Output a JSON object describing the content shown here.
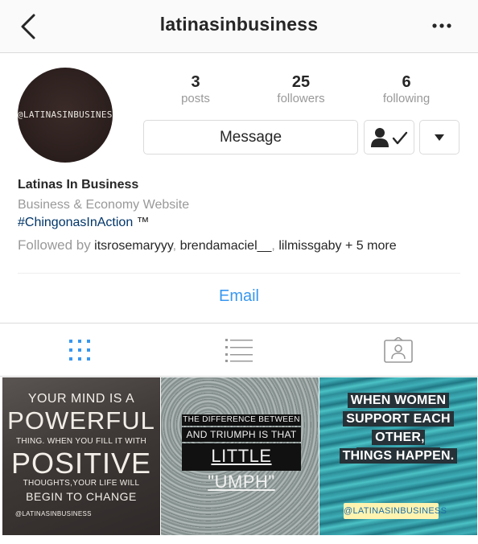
{
  "header": {
    "title": "latinasinbusiness",
    "back_icon": "chevron-left-icon",
    "more_icon": "ellipsis-icon"
  },
  "profile": {
    "avatar_text": "@LATINASINBUSINESS",
    "stats": [
      {
        "value": "3",
        "label": "posts"
      },
      {
        "value": "25",
        "label": "followers"
      },
      {
        "value": "6",
        "label": "following"
      }
    ],
    "message_label": "Message",
    "following_icon": "person-check-icon",
    "dropdown_icon": "triangle-down-icon"
  },
  "bio": {
    "name": "Latinas In Business",
    "category": "Business & Economy Website",
    "hashtag": "#ChingonasInAction",
    "tm": " ™",
    "followed_by_label": "Followed by",
    "followers": [
      "itsrosemaryyy",
      "brendamaciel__",
      "lilmissgaby"
    ],
    "more_text": "+ 5 more"
  },
  "contact": {
    "email_label": "Email"
  },
  "tabs": [
    {
      "icon": "grid-icon",
      "active": true
    },
    {
      "icon": "list-icon",
      "active": false
    },
    {
      "icon": "tagged-icon",
      "active": false
    }
  ],
  "posts": {
    "post1": {
      "l1": "YOUR MIND IS A",
      "l2": "POWERFUL",
      "l3": "THING. WHEN YOU FILL IT WITH",
      "l4": "POSITIVE",
      "l5": "THOUGHTS,YOUR LIFE WILL",
      "l6": "BEGIN TO CHANGE",
      "l7": "@LATINASINBUSINESS"
    },
    "post2": {
      "l1": "THE DIFFERENCE BETWEEN TRY",
      "l2": "AND TRIUMPH IS THAT",
      "l3": "LITTLE \"UMPH\""
    },
    "post3": {
      "lines": [
        "WHEN WOMEN",
        "SUPPORT EACH",
        "OTHER, INCREDIBLE",
        "THINGS HAPPEN."
      ],
      "handle": "@LATINASINBUSINESS"
    }
  },
  "colors": {
    "link_blue": "#3897f0",
    "hashtag_blue": "#003569",
    "muted_gray": "#999999",
    "border": "#dbdbdb"
  }
}
